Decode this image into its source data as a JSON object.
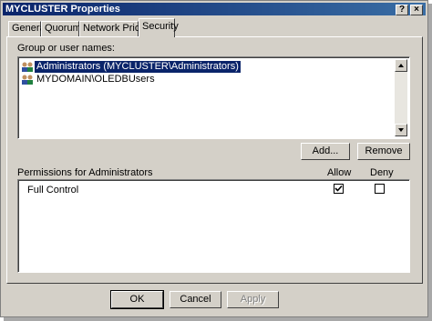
{
  "window": {
    "title": "MYCLUSTER Properties",
    "help_button": "?",
    "close_button": "×"
  },
  "tabs": [
    {
      "label": "General"
    },
    {
      "label": "Quorum"
    },
    {
      "label": "Network Priority"
    },
    {
      "label": "Security"
    }
  ],
  "active_tab": "Security",
  "security": {
    "group_label": "Group or user names:",
    "users": [
      {
        "name": "Administrators (MYCLUSTER\\Administrators)",
        "selected": true,
        "icon": "group-icon"
      },
      {
        "name": "MYDOMAIN\\OLEDBUsers",
        "selected": false,
        "icon": "group-icon"
      }
    ],
    "add_label": "Add...",
    "remove_label": "Remove",
    "permissions_label": "Permissions for Administrators",
    "allow_label": "Allow",
    "deny_label": "Deny",
    "permissions": [
      {
        "name": "Full Control",
        "allow": true,
        "deny": false
      }
    ]
  },
  "footer": {
    "ok_label": "OK",
    "cancel_label": "Cancel",
    "apply_label": "Apply",
    "apply_enabled": false
  }
}
